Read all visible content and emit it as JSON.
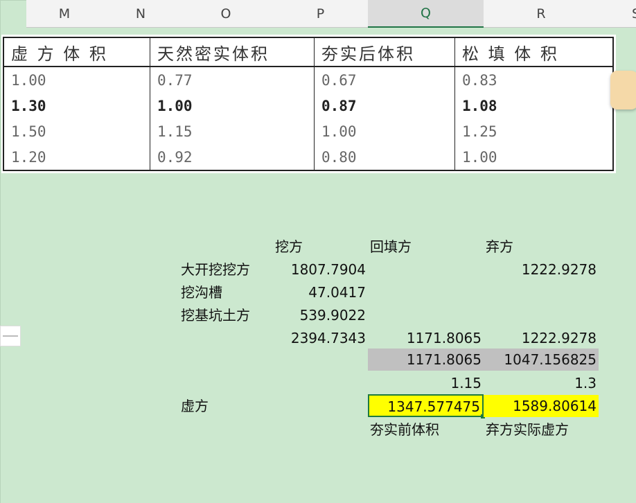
{
  "columns": [
    "M",
    "N",
    "O",
    "P",
    "Q",
    "R",
    "S"
  ],
  "active_column": "Q",
  "ref_table": {
    "headers": [
      "虚 方 体 积",
      "天然密实体积",
      "夯实后体积",
      "松 填 体 积"
    ],
    "rows": [
      [
        "1.00",
        "0.77",
        "0.67",
        "0.83"
      ],
      [
        "1.30",
        "1.00",
        "0.87",
        "1.08"
      ],
      [
        "1.50",
        "1.15",
        "1.00",
        "1.25"
      ],
      [
        "1.20",
        "0.92",
        "0.80",
        "1.00"
      ]
    ]
  },
  "grid": {
    "header_wa": "挖方",
    "header_hui": "回填方",
    "header_qi": "弃方",
    "row1_label": "大开挖挖方",
    "row1_wa": "1807.7904",
    "row1_qi": "1222.9278",
    "row2_label": "挖沟槽",
    "row2_wa": "47.0417",
    "row3_label": "挖基坑土方",
    "row3_wa": "539.9022",
    "sum_wa": "2394.7343",
    "sum_hui": "1171.8065",
    "sum_qi": "1222.9278",
    "g_hui": "1171.8065",
    "g_qi": "1047.156825",
    "factor_hui": "1.15",
    "factor_qi": "1.3",
    "xu_label": "虚方",
    "xu_hui": "1347.577475",
    "xu_qi": "1589.80614",
    "note_hui": "夯实前体积",
    "note_qi": "弃方实际虚方"
  }
}
